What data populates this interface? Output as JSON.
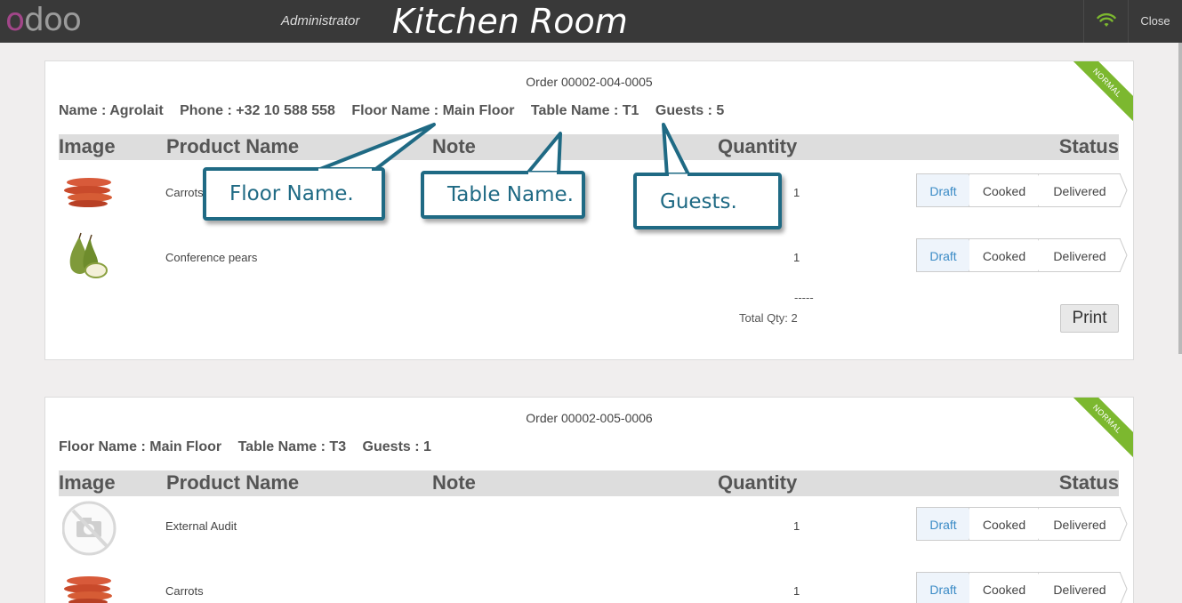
{
  "header": {
    "logo_o": "o",
    "logo_rest": "doo",
    "user": "Administrator",
    "title": "Kitchen Room",
    "close_label": "Close",
    "wifi_icon": "wifi-icon",
    "wifi_color": "#7cb82f"
  },
  "orders": [
    {
      "order_no": "Order 00002-004-0005",
      "ribbon": "NORMAL",
      "meta": {
        "name": "Name : Agrolait",
        "phone": "Phone : +32 10 588 558",
        "floor": "Floor Name : Main Floor",
        "table": "Table Name : T1",
        "guests": "Guests : 5"
      },
      "columns": {
        "image": "Image",
        "product": "Product Name",
        "note": "Note",
        "quantity": "Quantity",
        "status": "Status"
      },
      "lines": [
        {
          "product": "Carrots",
          "qty": "1",
          "image": "carrots-image"
        },
        {
          "product": "Conference pears",
          "qty": "1",
          "image": "pears-image"
        }
      ],
      "dash": "-----",
      "total": "Total Qty: 2",
      "print_label": "Print"
    },
    {
      "order_no": "Order 00002-005-0006",
      "ribbon": "NORMAL",
      "meta": {
        "floor": "Floor Name : Main Floor",
        "table": "Table Name : T3",
        "guests": "Guests : 1"
      },
      "columns": {
        "image": "Image",
        "product": "Product Name",
        "note": "Note",
        "quantity": "Quantity",
        "status": "Status"
      },
      "lines": [
        {
          "product": "External Audit",
          "qty": "1",
          "image": "no-image-placeholder"
        },
        {
          "product": "Carrots",
          "qty": "1",
          "image": "carrots-image"
        }
      ]
    }
  ],
  "status_steps": {
    "draft": "Draft",
    "cooked": "Cooked",
    "delivered": "Delivered"
  },
  "callouts": {
    "floor": "Floor Name.",
    "table": "Table Name.",
    "guests": "Guests."
  }
}
